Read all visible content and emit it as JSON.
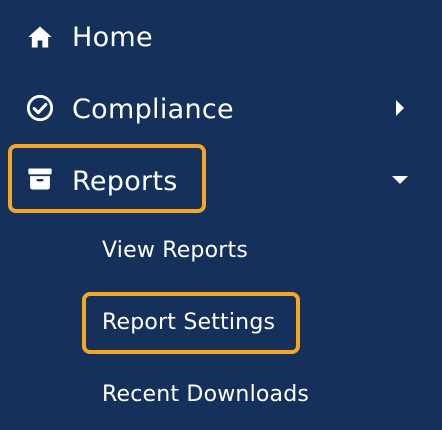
{
  "sidebar": {
    "items": [
      {
        "label": "Home",
        "icon": "home-icon"
      },
      {
        "label": "Compliance",
        "icon": "check-circle-icon"
      },
      {
        "label": "Reports",
        "icon": "archive-box-icon"
      }
    ],
    "reports_subitems": [
      {
        "label": "View Reports"
      },
      {
        "label": "Report Settings"
      },
      {
        "label": "Recent Downloads"
      }
    ]
  },
  "colors": {
    "background": "#15315b",
    "highlight": "#f5a623",
    "text": "#ffffff"
  }
}
